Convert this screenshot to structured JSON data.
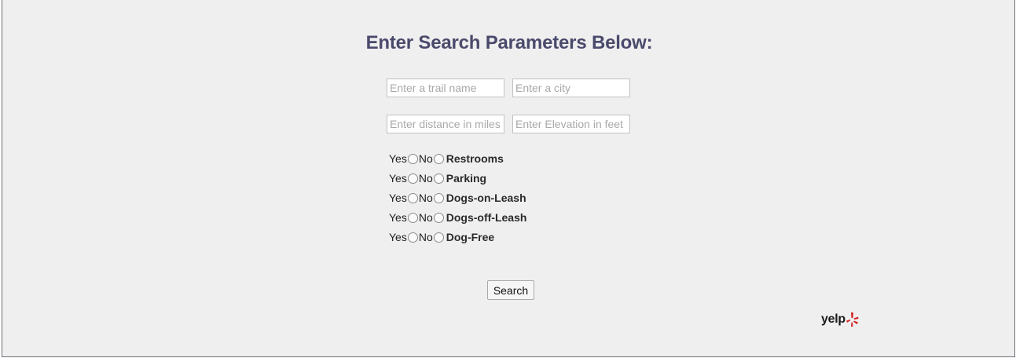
{
  "heading": "Enter Search Parameters Below:",
  "inputs": {
    "trail": {
      "placeholder": "Enter a trail name",
      "value": ""
    },
    "city": {
      "placeholder": "Enter a city",
      "value": ""
    },
    "distance": {
      "placeholder": "Enter distance in miles",
      "value": ""
    },
    "elevation": {
      "placeholder": "Enter Elevation in feet",
      "value": ""
    }
  },
  "options": {
    "yes": "Yes",
    "no": "No"
  },
  "amenities": [
    {
      "label": "Restrooms",
      "selected": null
    },
    {
      "label": "Parking",
      "selected": null
    },
    {
      "label": "Dogs-on-Leash",
      "selected": null
    },
    {
      "label": "Dogs-off-Leash",
      "selected": null
    },
    {
      "label": "Dog-Free",
      "selected": null
    }
  ],
  "search_button": "Search",
  "brand": {
    "name": "yelp",
    "icon": "yelp-burst-icon",
    "color": "#d32323"
  },
  "colors": {
    "heading": "#4a4a6c",
    "background": "#efefef"
  }
}
